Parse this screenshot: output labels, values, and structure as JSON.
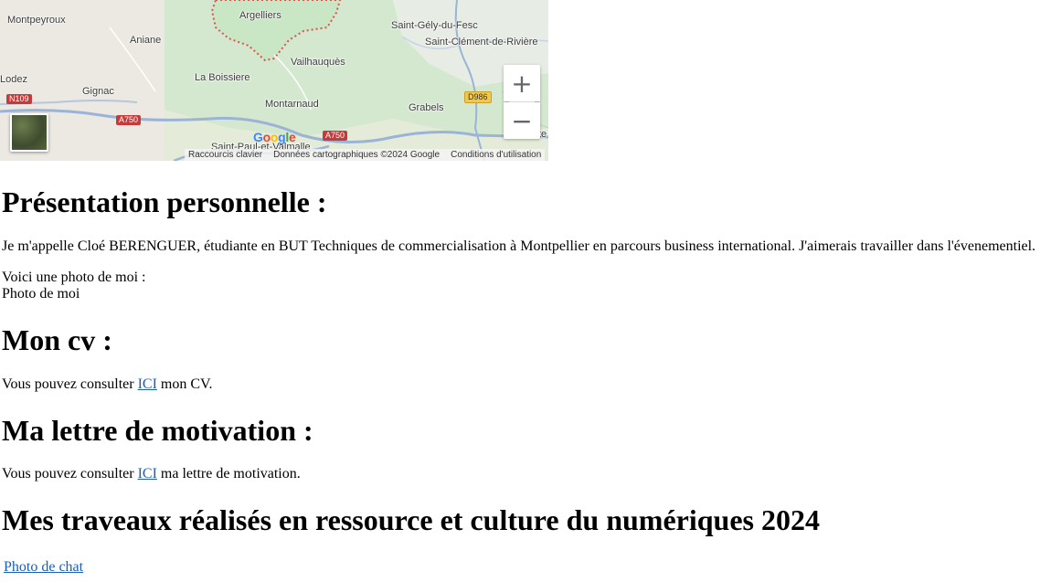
{
  "map": {
    "labels": {
      "montpeyroux": "Montpeyroux",
      "argelliers": "Argelliers",
      "saint_gely": "Saint-Gély-du-Fesc",
      "aniane": "Aniane",
      "saint_clement": "Saint-Clément-de-Rivière",
      "vailhauques": "Vailhauquès",
      "lodez": "Lodez",
      "la_boissiere": "La Boissiere",
      "gignac": "Gignac",
      "montarnaud": "Montarnaud",
      "grabels": "Grabels",
      "saint_paul": "Saint-Paul-et-Valmalle",
      "lattes_partial": "te"
    },
    "roads": {
      "n109": "N109",
      "a750_left": "A750",
      "a750_bottom": "A750",
      "d986": "D986"
    },
    "zoom_in_symbol": "+",
    "zoom_out_symbol": "−",
    "google_logo": [
      "G",
      "o",
      "o",
      "g",
      "l",
      "e"
    ],
    "attribution": {
      "shortcuts": "Raccourcis clavier",
      "data": "Données cartographiques ©2024 Google",
      "terms": "Conditions d'utilisation"
    },
    "colors": {
      "land": "#e4ecd9",
      "park": "#c9e6c5",
      "boundary": "#d9534f",
      "road": "#9bb3d6"
    }
  },
  "sections": {
    "presentation": {
      "title": "Présentation personnelle :",
      "paragraph": "Je m'appelle Cloé BERENGUER, étudiante en BUT Techniques de commercialisation à Montpellier en parcours business international. J'aimerais travailler dans l'évenementiel.",
      "photo_intro": "Voici une photo de moi :",
      "photo_alt": "Photo de moi"
    },
    "cv": {
      "title": "Mon cv :",
      "before": "Vous pouvez consulter ",
      "link": "ICI",
      "after": " mon CV."
    },
    "letter": {
      "title": "Ma lettre de motivation :",
      "before": "Vous pouvez consulter ",
      "link": "ICI",
      "after": " ma lettre de motivation."
    },
    "works": {
      "title": "Mes traveaux réalisés en ressource et culture du numériques 2024",
      "link": "Photo de chat"
    }
  }
}
